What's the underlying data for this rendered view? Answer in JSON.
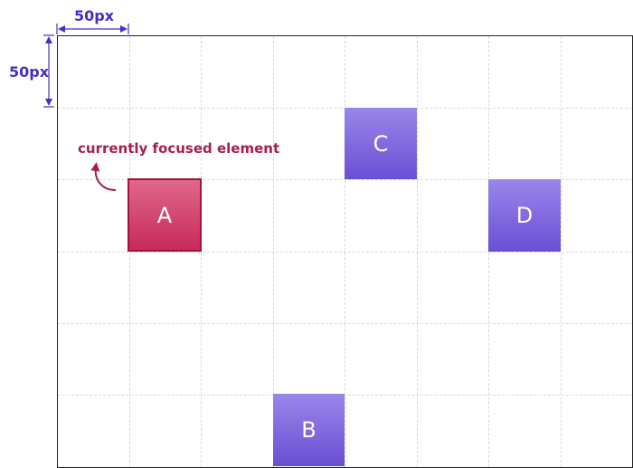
{
  "measurements": {
    "horizontal_label": "50px",
    "vertical_label": "50px"
  },
  "annotation": {
    "text": "currently focused element"
  },
  "boxes": {
    "a": {
      "label": "A"
    },
    "b": {
      "label": "B"
    },
    "c": {
      "label": "C"
    },
    "d": {
      "label": "D"
    }
  },
  "colors": {
    "focused_box": "#c62a5a",
    "element_box": "#7b62dd",
    "measurement": "#4a2ec2",
    "annotation": "#a61e4d",
    "grid_line": "#d9d9d9"
  }
}
